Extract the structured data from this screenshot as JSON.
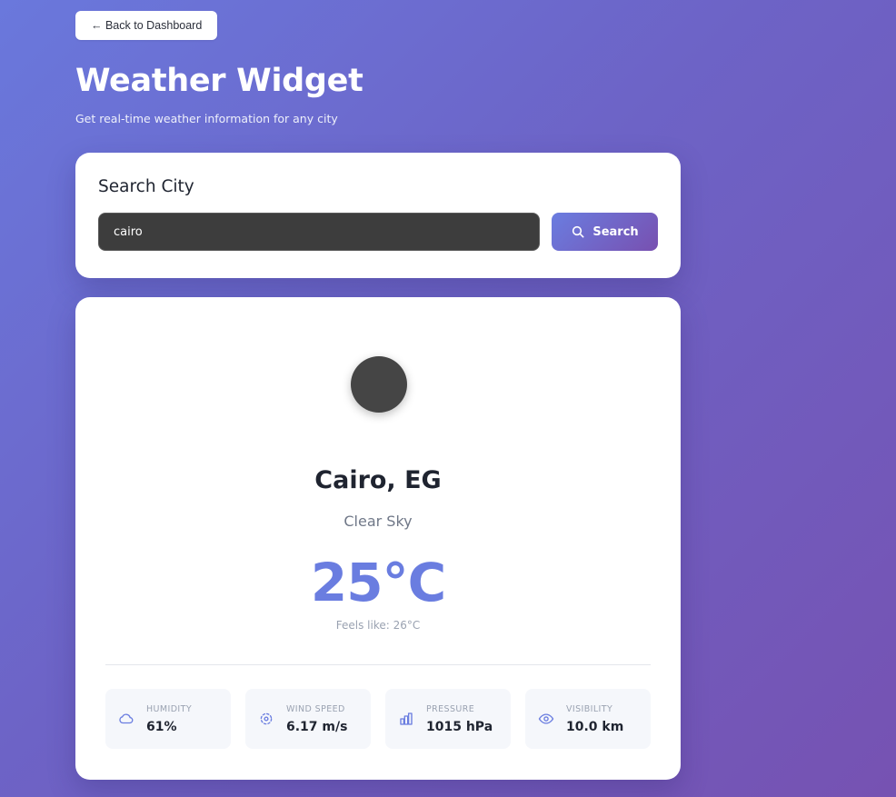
{
  "nav": {
    "back_label": "← Back to Dashboard"
  },
  "header": {
    "title": "Weather Widget",
    "subtitle": "Get real-time weather information for any city"
  },
  "search": {
    "title": "Search City",
    "value": "cairo",
    "button_label": "Search",
    "button_icon": "search-icon"
  },
  "weather": {
    "icon": "weather-icon",
    "city": "Cairo, EG",
    "condition": "Clear Sky",
    "temperature": "25°C",
    "feels_like": "Feels like: 26°C"
  },
  "stats": [
    {
      "icon": "cloud-icon",
      "label": "HUMIDITY",
      "value": "61%"
    },
    {
      "icon": "wind-icon",
      "label": "WIND SPEED",
      "value": "6.17 m/s"
    },
    {
      "icon": "bar-chart-icon",
      "label": "PRESSURE",
      "value": "1015 hPa"
    },
    {
      "icon": "eye-icon",
      "label": "VISIBILITY",
      "value": "10.0 km"
    }
  ],
  "colors": {
    "accent": "#6a7de0",
    "gradient_start": "#6a78dc",
    "gradient_end": "#7652b2"
  }
}
